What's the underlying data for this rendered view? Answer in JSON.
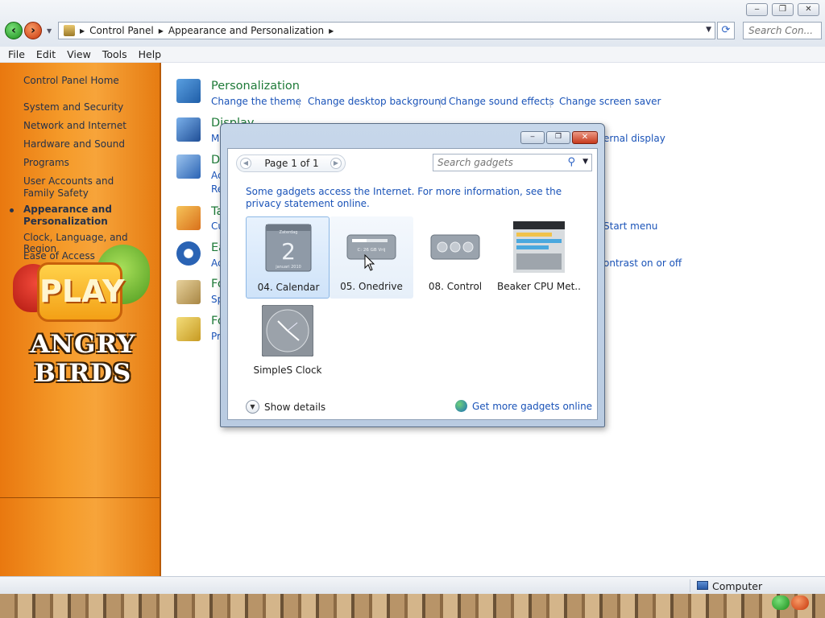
{
  "window": {
    "minimize": "‒",
    "maximize": "❐",
    "close": "✕"
  },
  "address_bar": {
    "breadcrumbs": [
      "Control Panel",
      "Appearance and Personalization"
    ],
    "search_placeholder": "Search Con..."
  },
  "menu": [
    "File",
    "Edit",
    "View",
    "Tools",
    "Help"
  ],
  "left_pane": {
    "home": "Control Panel Home",
    "items": [
      "System and Security",
      "Network and Internet",
      "Hardware and Sound",
      "Programs",
      "User Accounts and Family Safety",
      "Appearance and Personalization",
      "Clock, Language, and Region",
      "Ease of Access"
    ],
    "current_index": 5,
    "ad": {
      "button": "PLAY",
      "title": "ANGRY BIRDS"
    }
  },
  "main": {
    "personalization": {
      "title": "Personalization",
      "links": [
        "Change the theme",
        "Change desktop background",
        "Change sound effects",
        "Change screen saver"
      ]
    },
    "display": {
      "title": "Display",
      "link_fragment": "M",
      "visible_link": "ernal display"
    },
    "row3": {
      "title": "D",
      "link1": "Ac",
      "link2": "Re"
    },
    "row4": {
      "title": "Ta",
      "link": "Cu",
      "visible_link": "Start menu"
    },
    "row5": {
      "title": "Ea",
      "link": "Ac",
      "visible_link": "ontrast on or off"
    },
    "row6": {
      "title": "Fo",
      "link": "Sp"
    },
    "row7": {
      "title": "Fo",
      "link": "Pr"
    }
  },
  "gadget_dialog": {
    "pager": "Page 1 of 1",
    "search_placeholder": "Search gadgets",
    "info_text": "Some gadgets access the Internet.  For more information, see the privacy statement online.",
    "gadgets": [
      {
        "name": "04. Calendar",
        "state": "selected",
        "thumb_text": "2",
        "thumb_caption": "januari 2010",
        "thumb_header": "Zaterdag"
      },
      {
        "name": "05. Onedrive",
        "state": "hovered",
        "thumb_text": "C: 26 GB Vrij"
      },
      {
        "name": "08. Control",
        "state": "normal"
      },
      {
        "name": "Beaker CPU Met...",
        "state": "normal"
      },
      {
        "name": "SimpleS Clock",
        "state": "normal"
      }
    ],
    "show_details": "Show details",
    "get_more": "Get more gadgets online"
  },
  "status_bar": {
    "text": "Computer"
  },
  "colors": {
    "link_blue": "#1a53b8",
    "category_green": "#1e7a38",
    "left_pane_orange": "#f59b2a"
  }
}
